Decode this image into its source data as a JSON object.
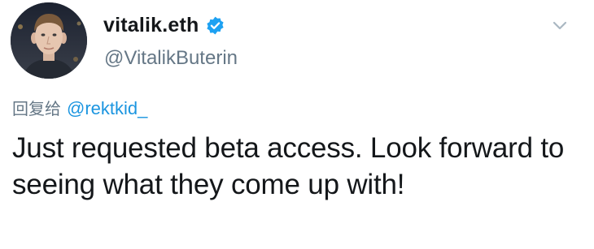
{
  "tweet": {
    "display_name": "vitalik.eth",
    "handle": "@VitalikButerin",
    "verified_icon": "verified-badge-icon",
    "menu_icon": "chevron-down-icon",
    "reply_prefix": "回复给",
    "reply_to": "@rektkid_",
    "text": "Just requested beta access. Look forward to seeing what they come up with!"
  },
  "colors": {
    "name": "#14171a",
    "secondary": "#657786",
    "link": "#1b95e0",
    "verified": "#1da1f2"
  }
}
